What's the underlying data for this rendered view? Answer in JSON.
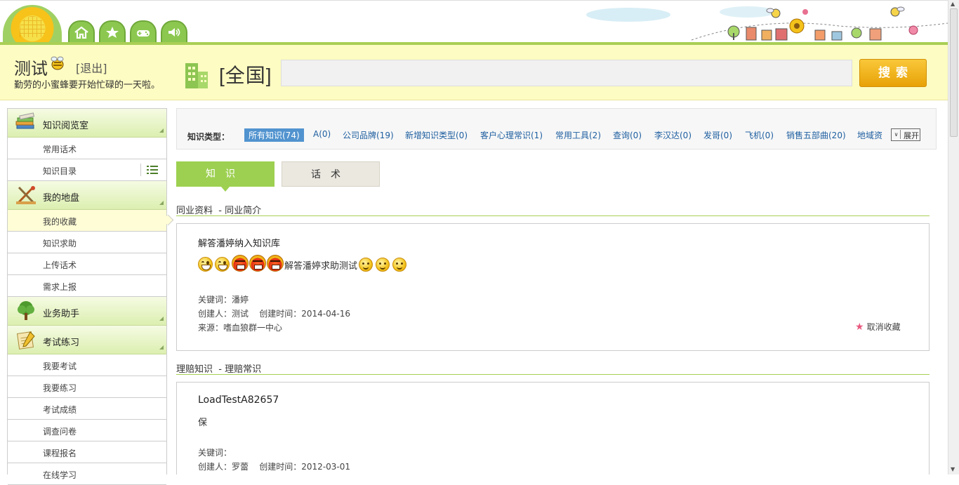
{
  "header": {
    "icons": [
      "home-icon",
      "star-icon",
      "gamepad-icon",
      "speaker-icon"
    ],
    "user_name": "测试",
    "logout": "[退出]",
    "welcome": "勤劳的小蜜蜂要开始忙碌的一天啦。",
    "region": "[全国]",
    "search_value": "",
    "search_button": "搜索"
  },
  "colors": {
    "accent_green": "#a9cf55",
    "band_yellow": "#fdfcc2",
    "search_button": "#f0b020",
    "selected_chip": "#5193cf",
    "link_blue": "#1f5fa0"
  },
  "sidebar": {
    "sections": [
      {
        "label": "知识阅览室",
        "icon": "books-icon",
        "items": [
          "常用话术",
          "知识目录"
        ]
      },
      {
        "label": "我的地盘",
        "icon": "tools-icon",
        "items": [
          "我的收藏",
          "知识求助",
          "上传话术",
          "需求上报"
        ]
      },
      {
        "label": "业务助手",
        "icon": "tree-icon",
        "items": []
      },
      {
        "label": "考试练习",
        "icon": "notepad-icon",
        "items": [
          "我要考试",
          "我要练习",
          "考试成绩",
          "调查问卷",
          "课程报名",
          "在线学习"
        ]
      }
    ],
    "active_item": "我的收藏"
  },
  "filter": {
    "title": "知识类型：",
    "chips": [
      "所有知识(74)",
      "A(0)",
      "公司品牌(19)",
      "新增知识类型(0)",
      "客户心理常识(1)",
      "常用工具(2)",
      "查询(0)",
      "李汉达(0)",
      "发哥(0)",
      "飞机(0)",
      "销售五部曲(20)",
      "地域资"
    ],
    "selected": "所有知识(74)",
    "expand": "展开"
  },
  "tabs": {
    "knowledge": "知识",
    "script": "话术"
  },
  "entries": [
    {
      "category": "同业资料",
      "subcategory": "- 同业简介",
      "title": "解答潘婷纳入知识库",
      "body_text": "解答潘婷求助测试",
      "keywords": "关键词：潘婷",
      "creator": "创建人：测试",
      "created": "创建时间：2014-04-16",
      "source": "来源：嗜血狼群一中心",
      "action": "取消收藏"
    },
    {
      "category": "理赔知识",
      "subcategory": "- 理赔常识",
      "title": "LoadTestA82657",
      "body_text": "保",
      "keywords": "关键词：",
      "creator": "创建人：罗蕾",
      "created": "创建时间：2012-03-01"
    }
  ]
}
